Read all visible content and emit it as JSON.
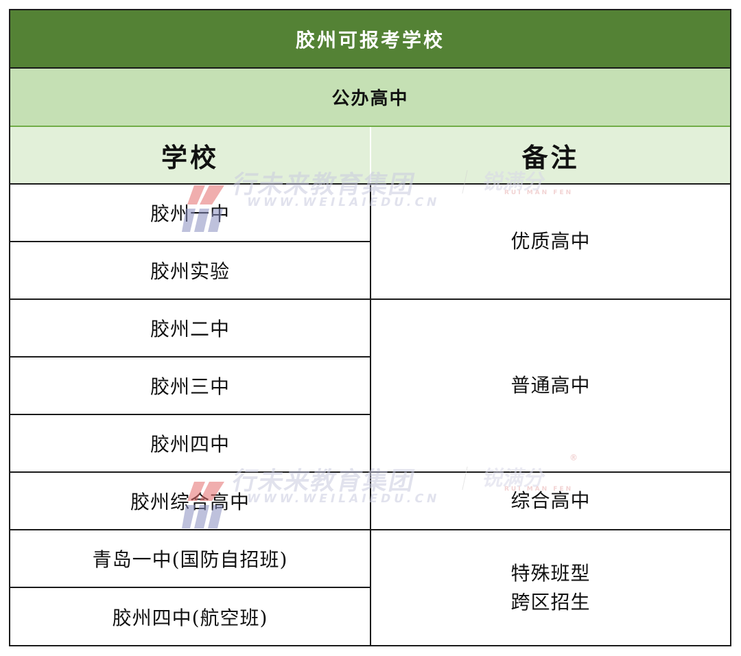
{
  "table": {
    "title": "胶州可报考学校",
    "subtitle": "公办高中",
    "headers": {
      "school": "学校",
      "note": "备注"
    },
    "schools": [
      "胶州一中",
      "胶州实验",
      "胶州二中",
      "胶州三中",
      "胶州四中",
      "胶州综合高中",
      "青岛一中(国防自招班)",
      "胶州四中(航空班)"
    ],
    "notes": {
      "quality": "优质高中",
      "ordinary": "普通高中",
      "comprehensive": "综合高中",
      "special_line1": "特殊班型",
      "special_line2": "跨区招生"
    }
  },
  "watermark": {
    "cn": "行未来教育集团",
    "en": "WWW.WEILAIEDU.CN",
    "brand": "锐满分",
    "brand_en": "RUI MAN FEN",
    "registered": "®"
  },
  "colors": {
    "title_bg": "#548235",
    "subtitle_bg": "#c5e0b4",
    "header_bg": "#e2f0d9",
    "watermark_red": "#e46c6c",
    "watermark_blue": "#8a90c0"
  }
}
